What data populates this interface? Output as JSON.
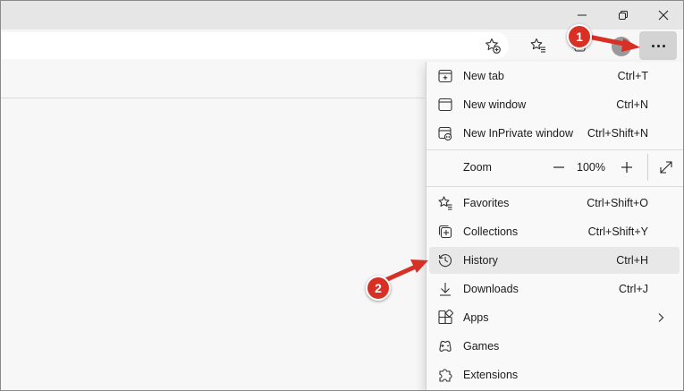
{
  "window": {
    "minimize_icon": "minimize-icon",
    "restore_icon": "restore-icon",
    "close_icon": "close-icon"
  },
  "toolbar": {
    "add_favorite_icon": "star-plus-icon",
    "favorites_icon": "star-list-icon",
    "collections_icon": "collections-icon",
    "profile_icon": "avatar",
    "more_icon": "more-horizontal-icon"
  },
  "menu": {
    "new_tab": {
      "label": "New tab",
      "shortcut": "Ctrl+T"
    },
    "new_window": {
      "label": "New window",
      "shortcut": "Ctrl+N"
    },
    "new_inprivate": {
      "label": "New InPrivate window",
      "shortcut": "Ctrl+Shift+N"
    },
    "zoom": {
      "label": "Zoom",
      "value": "100%"
    },
    "favorites": {
      "label": "Favorites",
      "shortcut": "Ctrl+Shift+O"
    },
    "collections": {
      "label": "Collections",
      "shortcut": "Ctrl+Shift+Y"
    },
    "history": {
      "label": "History",
      "shortcut": "Ctrl+H"
    },
    "downloads": {
      "label": "Downloads",
      "shortcut": "Ctrl+J"
    },
    "apps": {
      "label": "Apps"
    },
    "games": {
      "label": "Games"
    },
    "extensions": {
      "label": "Extensions"
    }
  },
  "callouts": {
    "step1": "1",
    "step2": "2",
    "color": "#d93025"
  }
}
